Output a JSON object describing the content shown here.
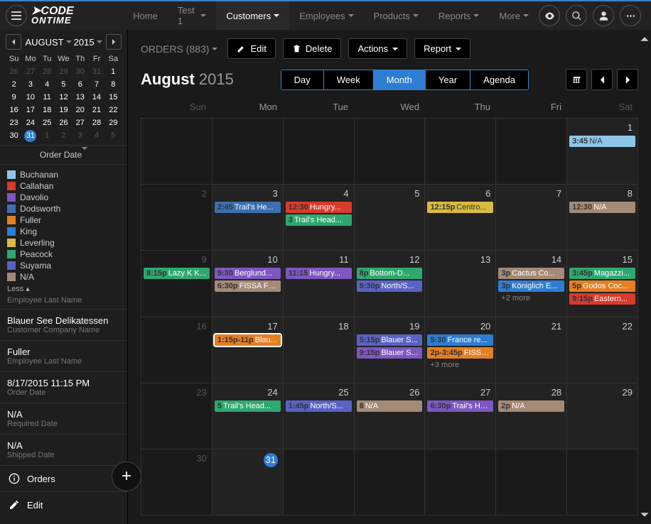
{
  "brand": {
    "line1": "CODE",
    "line2": "ONTIME"
  },
  "nav": {
    "items": [
      {
        "label": "Home",
        "dropdown": false
      },
      {
        "label": "Test 1",
        "dropdown": true
      },
      {
        "label": "Customers",
        "dropdown": true,
        "active": true
      },
      {
        "label": "Employees",
        "dropdown": true
      },
      {
        "label": "Products",
        "dropdown": true
      },
      {
        "label": "Reports",
        "dropdown": true
      },
      {
        "label": "More",
        "dropdown": true
      }
    ]
  },
  "toolbar": {
    "context": "ORDERS (883)",
    "edit": "Edit",
    "delete": "Delete",
    "actions": "Actions",
    "report": "Report"
  },
  "calHeader": {
    "month": "August",
    "year": "2015"
  },
  "views": [
    "Day",
    "Week",
    "Month",
    "Year",
    "Agenda"
  ],
  "activeView": "Month",
  "mini": {
    "title": "AUGUST",
    "year": "2015",
    "dow": [
      "Su",
      "Mo",
      "Tu",
      "We",
      "Th",
      "Fr",
      "Sa"
    ],
    "rows": [
      [
        {
          "n": "26",
          "d": 1
        },
        {
          "n": "27",
          "d": 1
        },
        {
          "n": "28",
          "d": 1
        },
        {
          "n": "29",
          "d": 1
        },
        {
          "n": "30",
          "d": 1
        },
        {
          "n": "31",
          "d": 1
        },
        {
          "n": "1"
        }
      ],
      [
        {
          "n": "2"
        },
        {
          "n": "3"
        },
        {
          "n": "4"
        },
        {
          "n": "5"
        },
        {
          "n": "6"
        },
        {
          "n": "7"
        },
        {
          "n": "8"
        }
      ],
      [
        {
          "n": "9"
        },
        {
          "n": "10"
        },
        {
          "n": "11"
        },
        {
          "n": "12"
        },
        {
          "n": "13"
        },
        {
          "n": "14"
        },
        {
          "n": "15"
        }
      ],
      [
        {
          "n": "16"
        },
        {
          "n": "17"
        },
        {
          "n": "18"
        },
        {
          "n": "19"
        },
        {
          "n": "20"
        },
        {
          "n": "21"
        },
        {
          "n": "22"
        }
      ],
      [
        {
          "n": "23"
        },
        {
          "n": "24"
        },
        {
          "n": "25"
        },
        {
          "n": "26"
        },
        {
          "n": "27"
        },
        {
          "n": "28"
        },
        {
          "n": "29"
        }
      ],
      [
        {
          "n": "30"
        },
        {
          "n": "31",
          "today": 1
        },
        {
          "n": "1",
          "d": 1
        },
        {
          "n": "2",
          "d": 1
        },
        {
          "n": "3",
          "d": 1
        },
        {
          "n": "4",
          "d": 1
        },
        {
          "n": "5",
          "d": 1
        }
      ]
    ]
  },
  "filterField": "Order Date",
  "legend": {
    "items": [
      {
        "label": "Buchanan",
        "c": "#8ec6e8"
      },
      {
        "label": "Callahan",
        "c": "#d93a2b"
      },
      {
        "label": "Davolio",
        "c": "#7e57c2"
      },
      {
        "label": "Dodsworth",
        "c": "#3b6fb0"
      },
      {
        "label": "Fuller",
        "c": "#e67e22"
      },
      {
        "label": "King",
        "c": "#2d7dd2"
      },
      {
        "label": "Leverling",
        "c": "#d9bb43"
      },
      {
        "label": "Peacock",
        "c": "#2ea86f"
      },
      {
        "label": "Suyama",
        "c": "#5a62c4"
      },
      {
        "label": "N/A",
        "c": "#a58a77"
      }
    ],
    "less": "Less",
    "heading": "Employee Last Name"
  },
  "details": [
    {
      "v": "Blauer See Delikatessen",
      "l": "Customer Company Name"
    },
    {
      "v": "Fuller",
      "l": "Employee Last Name"
    },
    {
      "v": "8/17/2015 11:15 PM",
      "l": "Order Date"
    },
    {
      "v": "N/A",
      "l": "Required Date"
    },
    {
      "v": "N/A",
      "l": "Shipped Date"
    }
  ],
  "sideActions": {
    "orders": "Orders",
    "edit": "Edit"
  },
  "dow": [
    {
      "l": "Sun",
      "d": 1
    },
    {
      "l": "Mon"
    },
    {
      "l": "Tue"
    },
    {
      "l": "Wed"
    },
    {
      "l": "Thu"
    },
    {
      "l": "Fri"
    },
    {
      "l": "Sat",
      "d": 1
    }
  ],
  "weeks": [
    [
      {
        "n": "",
        "d": 1
      },
      {
        "n": "",
        "d": 1
      },
      {
        "n": "",
        "d": 1
      },
      {
        "n": "",
        "d": 1
      },
      {
        "n": "",
        "d": 1
      },
      {
        "n": "",
        "d": 1
      },
      {
        "n": "1",
        "ev": [
          {
            "t": "3:45",
            "x": "N/A",
            "c": "#8ec6e8",
            "dk": 1
          }
        ]
      }
    ],
    [
      {
        "n": "2",
        "d": 1
      },
      {
        "n": "3",
        "ev": [
          {
            "t": "2:45",
            "x": "Trail's He...",
            "c": "#3b6fb0"
          }
        ]
      },
      {
        "n": "4",
        "ev": [
          {
            "t": "12:30",
            "x": "Hungry...",
            "c": "#d93a2b"
          },
          {
            "t": "3",
            "x": "Trail's Head...",
            "c": "#2ea86f"
          }
        ]
      },
      {
        "n": "5"
      },
      {
        "n": "6",
        "ev": [
          {
            "t": "12:15p",
            "x": "Centro...",
            "c": "#d9bb43",
            "dk": 1
          }
        ]
      },
      {
        "n": "7"
      },
      {
        "n": "8",
        "ev": [
          {
            "t": "12:30",
            "x": "N/A",
            "c": "#a58a77"
          }
        ]
      }
    ],
    [
      {
        "n": "9",
        "d": 1,
        "ev": [
          {
            "t": "8:15p",
            "x": "Lazy K K...",
            "c": "#2ea86f"
          }
        ]
      },
      {
        "n": "10",
        "ev": [
          {
            "t": "9:30",
            "x": "Berglund...",
            "c": "#7e57c2"
          },
          {
            "t": "6:30p",
            "x": "FISSA Fa...",
            "c": "#a58a77"
          }
        ]
      },
      {
        "n": "11",
        "ev": [
          {
            "t": "11:15",
            "x": "Hungry...",
            "c": "#7e57c2"
          }
        ]
      },
      {
        "n": "12",
        "ev": [
          {
            "t": "8p",
            "x": "Bottom-D...",
            "c": "#2ea86f"
          },
          {
            "t": "9:30p",
            "x": "North/S...",
            "c": "#5a62c4"
          }
        ]
      },
      {
        "n": "13"
      },
      {
        "n": "14",
        "ev": [
          {
            "t": "3p",
            "x": "Cactus Co...",
            "c": "#a58a77"
          },
          {
            "t": "3p",
            "x": "Königlich E...",
            "c": "#2d7dd2"
          }
        ],
        "more": "+2 more"
      },
      {
        "n": "15",
        "ev": [
          {
            "t": "3:45p",
            "x": "Magazzi...",
            "c": "#2ea86f"
          },
          {
            "t": "5p",
            "x": "Godos Coc...",
            "c": "#e67e22"
          },
          {
            "t": "9:15p",
            "x": "Eastern...",
            "c": "#d93a2b"
          }
        ]
      }
    ],
    [
      {
        "n": "16",
        "d": 1
      },
      {
        "n": "17",
        "ev": [
          {
            "t": "1:15p-11p",
            "x": "Blau...",
            "c": "#e67e22",
            "sel": 1
          }
        ]
      },
      {
        "n": "18"
      },
      {
        "n": "19",
        "ev": [
          {
            "t": "5:15p",
            "x": "Blauer S...",
            "c": "#5a62c4"
          },
          {
            "t": "9:15p",
            "x": "Blauer S...",
            "c": "#7e57c2"
          }
        ]
      },
      {
        "n": "20",
        "ev": [
          {
            "t": "5:30",
            "x": "France re...",
            "c": "#2d7dd2"
          },
          {
            "t": "2p-3:45p",
            "x": "FISSA...",
            "c": "#e67e22"
          }
        ],
        "more": "+3 more"
      },
      {
        "n": "21"
      },
      {
        "n": "22"
      }
    ],
    [
      {
        "n": "23",
        "d": 1
      },
      {
        "n": "24",
        "ev": [
          {
            "t": "5",
            "x": "Trail's Head...",
            "c": "#2ea86f"
          }
        ]
      },
      {
        "n": "25",
        "ev": [
          {
            "t": "1:45p",
            "x": "North/S...",
            "c": "#5a62c4"
          }
        ]
      },
      {
        "n": "26",
        "ev": [
          {
            "t": "8",
            "x": "N/A",
            "c": "#a58a77"
          }
        ]
      },
      {
        "n": "27",
        "ev": [
          {
            "t": "6:30p",
            "x": "Trail's He...",
            "c": "#7e57c2"
          }
        ]
      },
      {
        "n": "28",
        "ev": [
          {
            "t": "2p",
            "x": "N/A",
            "c": "#a58a77"
          }
        ]
      },
      {
        "n": "29"
      }
    ],
    [
      {
        "n": "30",
        "d": 1
      },
      {
        "n": "31",
        "today": 1
      },
      {
        "n": "",
        "d": 1
      },
      {
        "n": "",
        "d": 1
      },
      {
        "n": "",
        "d": 1
      },
      {
        "n": "",
        "d": 1
      },
      {
        "n": "",
        "d": 1
      }
    ]
  ]
}
